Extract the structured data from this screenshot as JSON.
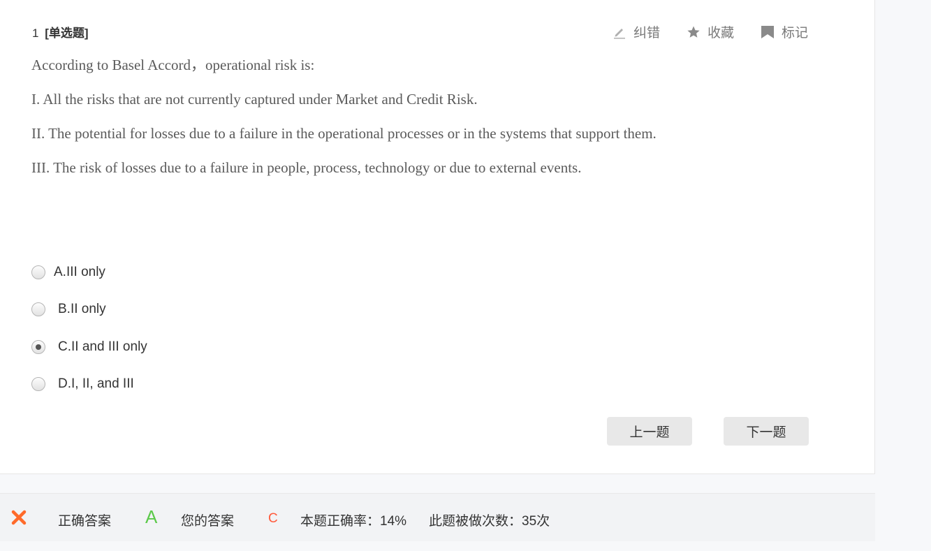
{
  "question": {
    "number": "1",
    "type": "[单选题]",
    "stem": [
      "According to Basel Accord，operational risk is:",
      "I. All the risks that are not currently captured under Market and Credit Risk.",
      "II. The potential for losses due to a failure in the operational processes or in the systems that support them.",
      "III. The risk of losses due to a failure in people, process, technology or due to external events."
    ],
    "options": [
      {
        "label": "A.III only",
        "checked": false
      },
      {
        "label": "B.II only",
        "checked": false
      },
      {
        "label": "C.II and III only",
        "checked": true
      },
      {
        "label": "D.I, II, and III",
        "checked": false
      }
    ]
  },
  "tools": {
    "correct_error": "纠错",
    "favorite": "收藏",
    "mark": "标记"
  },
  "nav": {
    "prev": "上一题",
    "next": "下一题"
  },
  "result": {
    "correct_label": "正确答案",
    "correct_answer": "A",
    "your_label": "您的答案",
    "your_answer": "C",
    "accuracy": "本题正确率：14%",
    "attempts": "此题被做次数：35次"
  },
  "colors": {
    "correct": "#5cc94a",
    "wrong": "#ff5a3c",
    "icon": "#9a9a9a"
  },
  "icons": {
    "correct_error": "pencil-icon",
    "favorite": "star-icon",
    "mark": "bookmark-icon",
    "status": "close-icon"
  }
}
